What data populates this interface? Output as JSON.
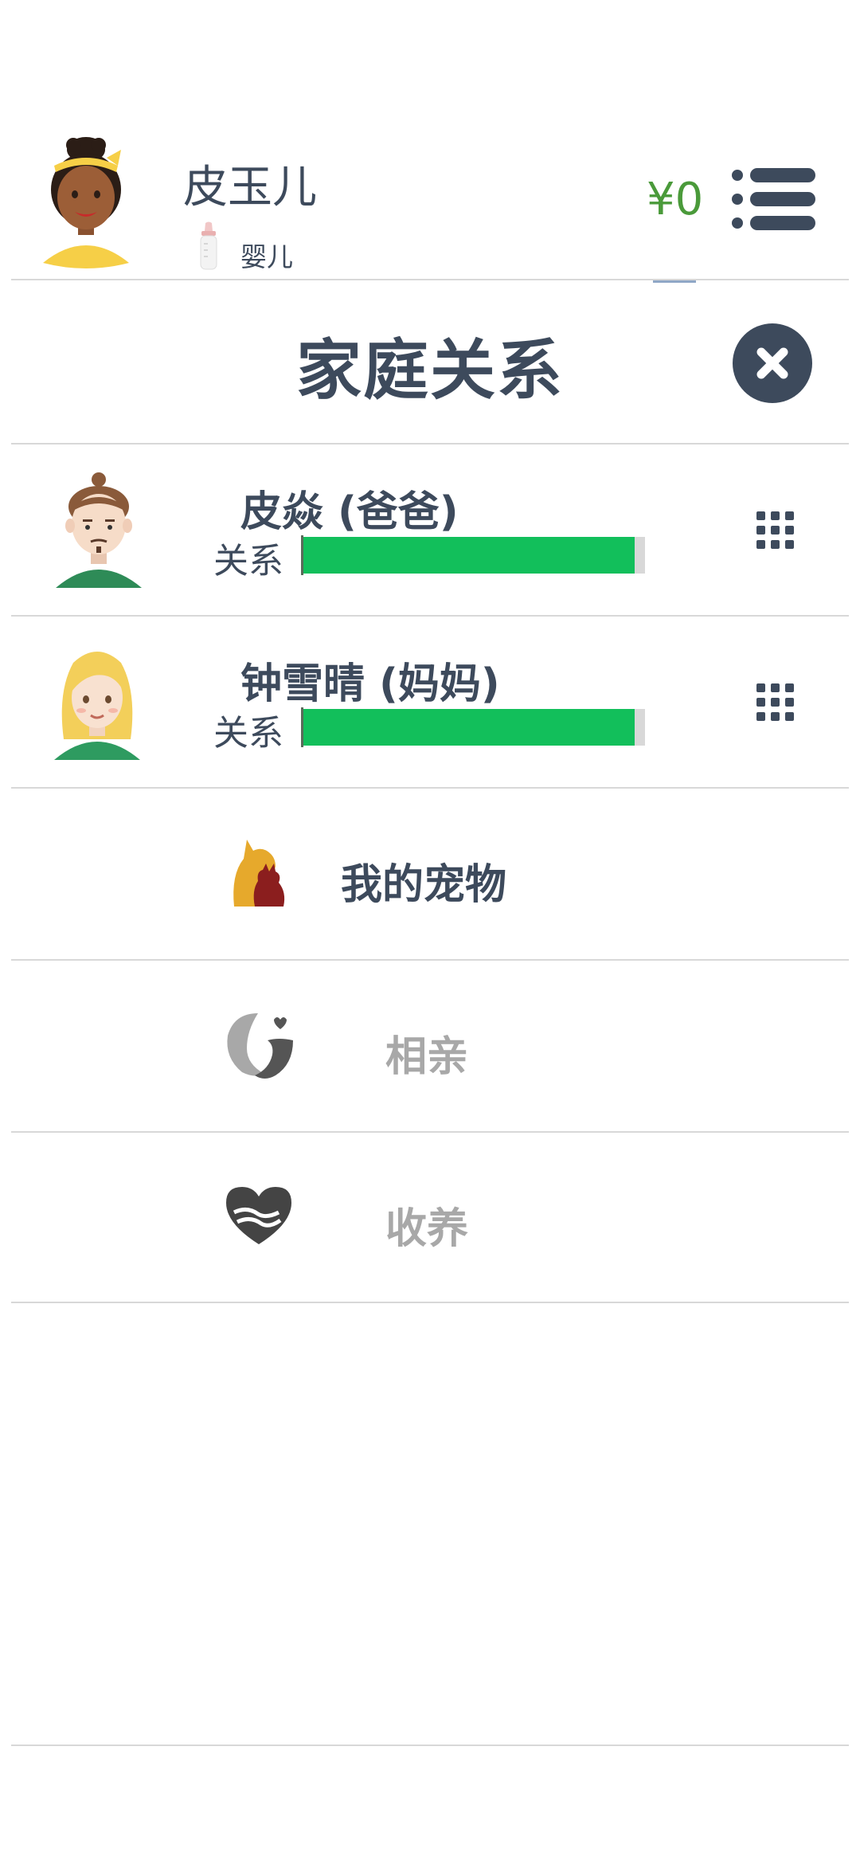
{
  "header": {
    "player_name": "皮玉儿",
    "life_stage": "婴儿",
    "life_stage_icon": "baby-bottle-icon",
    "money": "¥0",
    "money_color": "#4a9a3a",
    "menu_icon": "list-menu-icon"
  },
  "panel": {
    "title": "家庭关系",
    "close_icon": "close-icon"
  },
  "family": [
    {
      "name": "皮焱 (爸爸)",
      "relation_label": "关系",
      "relation_level": 0.97,
      "avatar": "father-avatar"
    },
    {
      "name": "钟雪晴 (妈妈)",
      "relation_label": "关系",
      "relation_level": 0.97,
      "avatar": "mother-avatar"
    }
  ],
  "options": [
    {
      "label": "我的宠物",
      "icon": "pets-icon",
      "enabled": true
    },
    {
      "label": "相亲",
      "icon": "matchmaking-icon",
      "enabled": false
    },
    {
      "label": "收养",
      "icon": "adoption-icon",
      "enabled": false
    }
  ],
  "colors": {
    "text_primary": "#3d4a5c",
    "text_disabled": "#a8a8a8",
    "relation_bar": "#12bf5b",
    "divider": "#d8d8d8"
  }
}
